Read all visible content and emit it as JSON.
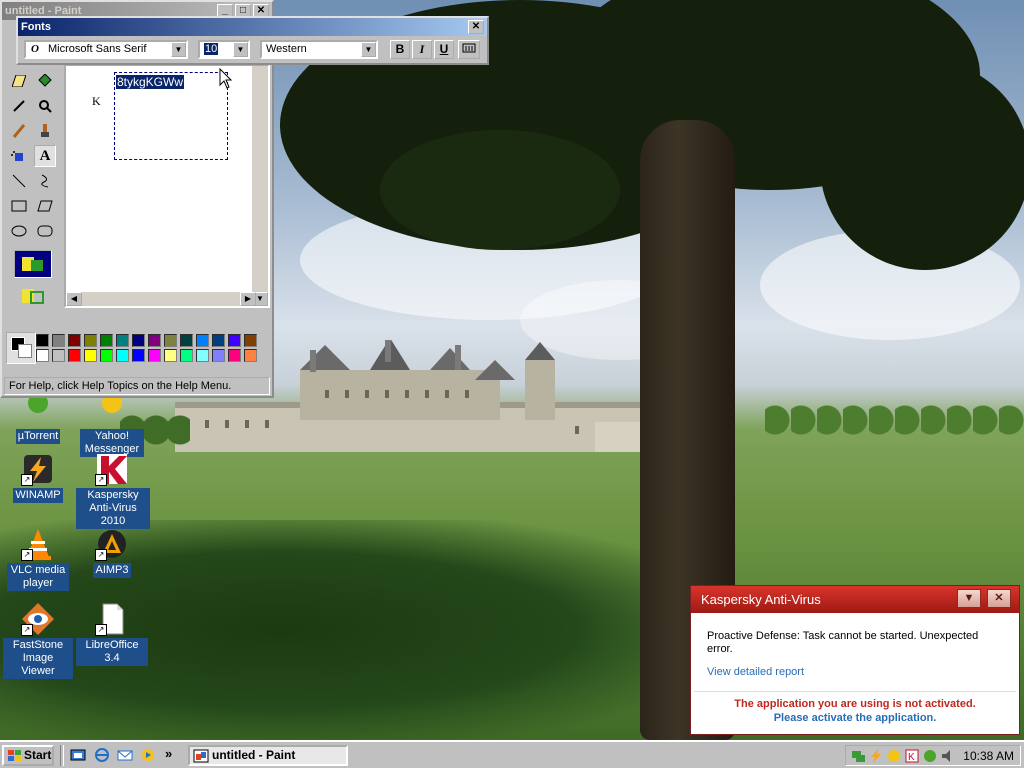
{
  "paint": {
    "title": "untitled - Paint",
    "status": "For Help, click Help Topics on the Help Menu.",
    "canvas_text": "8tykgKGWw",
    "canvas_char": "K",
    "palette_row1": [
      "#000000",
      "#808080",
      "#800000",
      "#808000",
      "#008000",
      "#008080",
      "#000080",
      "#800080",
      "#808040",
      "#004040",
      "#0080ff",
      "#004080",
      "#4000ff",
      "#804000"
    ],
    "palette_row2": [
      "#ffffff",
      "#c0c0c0",
      "#ff0000",
      "#ffff00",
      "#00ff00",
      "#00ffff",
      "#0000ff",
      "#ff00ff",
      "#ffff80",
      "#00ff80",
      "#80ffff",
      "#8080ff",
      "#ff0080",
      "#ff8040"
    ]
  },
  "fonts_toolbar": {
    "title": "Fonts",
    "font_name": "Microsoft Sans Serif",
    "font_size": "10",
    "script": "Western",
    "bold": "B",
    "italic": "I",
    "underline": "U"
  },
  "desktop_icons": [
    {
      "label": "µTorrent"
    },
    {
      "label": "Yahoo! Messenger"
    },
    {
      "label": "WINAMP"
    },
    {
      "label": "Kaspersky Anti-Virus 2010"
    },
    {
      "label": "VLC media player"
    },
    {
      "label": "AIMP3"
    },
    {
      "label": "FastStone Image Viewer"
    },
    {
      "label": "LibreOffice 3.4"
    }
  ],
  "kaspersky": {
    "title": "Kaspersky Anti-Virus",
    "message": "Proactive Defense: Task cannot be started. Unexpected error.",
    "link": "View detailed report",
    "warning": "The application you are using is not activated.",
    "activate": "Please activate the application.",
    "accent": "#c0271e"
  },
  "taskbar": {
    "start": "Start",
    "quicklaunch_more": "»",
    "task_label": "untitled - Paint",
    "clock": "10:38 AM"
  }
}
